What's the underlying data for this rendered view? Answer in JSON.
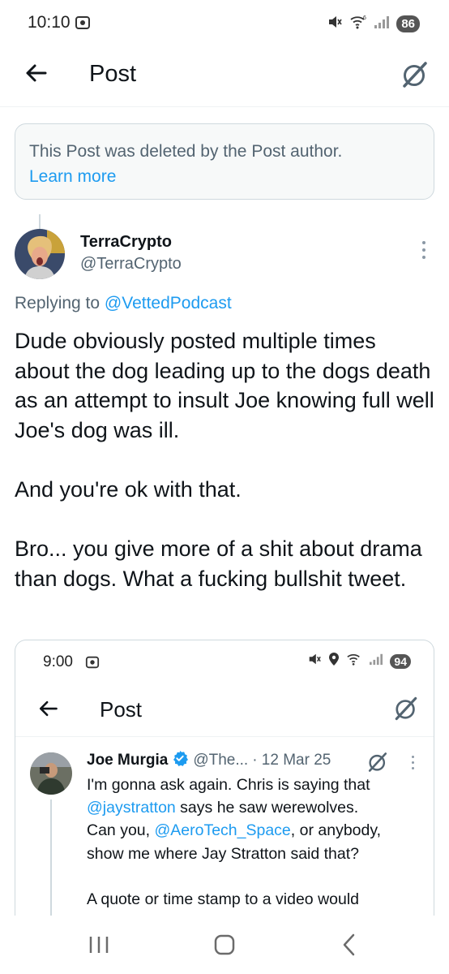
{
  "status_bar": {
    "time": "10:10",
    "battery": "86"
  },
  "top_bar": {
    "title": "Post"
  },
  "deleted_notice": {
    "text": "This Post was deleted by the Post author.",
    "link": "Learn more"
  },
  "post": {
    "author_name": "TerraCrypto",
    "author_handle": "@TerraCrypto",
    "replying_prefix": "Replying to",
    "replying_to": "@VettedPodcast",
    "paragraphs": [
      "Dude obviously posted multiple times about the dog leading up to the dogs death as an attempt to insult Joe knowing full well Joe's dog was ill.",
      "And you're ok with that.",
      "Bro... you give more of a shit about drama than dogs. What a fucking bullshit tweet."
    ]
  },
  "embedded": {
    "time": "9:00",
    "battery": "94",
    "title": "Post",
    "author_name": "Joe Murgia",
    "author_handle": "@The...",
    "date": "· 12 Mar 25",
    "line1_text": "I'm gonna ask again. Chris is saying that",
    "mention1": "@jaystratton",
    "line2_rest": " says he saw werewolves.",
    "line3_start": "Can you, ",
    "mention2": "@AeroTech_Space",
    "line3_rest": ", or anybody,",
    "line4": "show me where Jay Stratton said that?",
    "line5": "A quote or time stamp to a video would"
  },
  "colors": {
    "accent": "#1d9bf0",
    "secondary_text": "#536471",
    "primary_text": "#0f1419"
  },
  "icons": [
    "back-arrow-icon",
    "grok-icon",
    "more-icon",
    "verified-icon",
    "recent-apps-icon",
    "home-icon",
    "nav-back-icon"
  ]
}
